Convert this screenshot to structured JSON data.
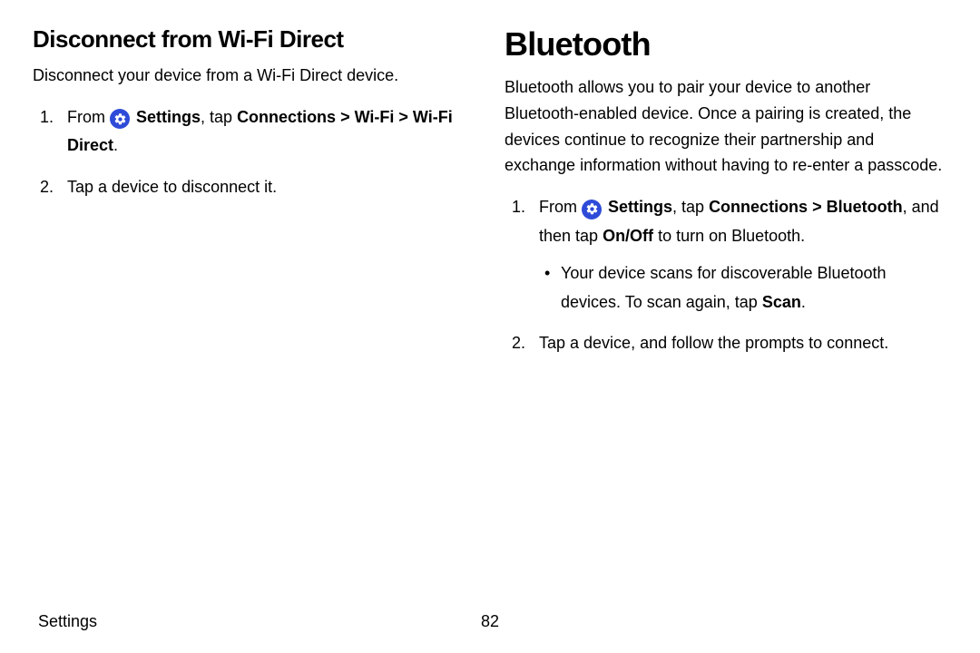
{
  "left": {
    "heading": "Disconnect from Wi-Fi Direct",
    "intro": "Disconnect your device from a Wi-Fi Direct device.",
    "step1": {
      "prefix": "From ",
      "settings": "Settings",
      "mid": ", tap ",
      "path": "Connections > Wi-Fi > Wi-Fi Direct",
      "suffix": "."
    },
    "step2": "Tap a device to disconnect it."
  },
  "right": {
    "heading": "Bluetooth",
    "intro": "Bluetooth allows you to pair your device to another Bluetooth-enabled device. Once a pairing is created, the devices continue to recognize their partnership and exchange information without having to re-enter a passcode.",
    "step1": {
      "prefix": "From ",
      "settings": "Settings",
      "mid1": ", tap ",
      "path": "Connections > Bluetooth",
      "mid2": ", and then tap ",
      "onoff": "On/Off",
      "suffix": " to turn on Bluetooth."
    },
    "step1_sub": {
      "pre": "Your device scans for discoverable Bluetooth devices. To scan again, tap ",
      "scan": "Scan",
      "post": "."
    },
    "step2": "Tap a device, and follow the prompts to connect."
  },
  "footer": {
    "section": "Settings",
    "page": "82"
  },
  "icons": {
    "gear": "settings-gear"
  }
}
